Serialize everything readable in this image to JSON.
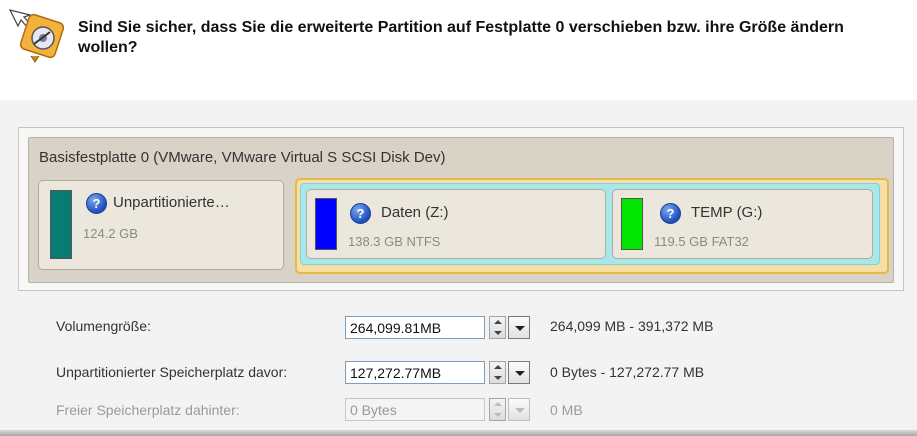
{
  "question": "Sind Sie sicher, dass Sie die erweiterte Partition auf Festplatte 0 verschieben bzw. ihre Größe ändern wollen?",
  "disk": {
    "title": "Basisfestplatte 0 (VMware, VMware Virtual S SCSI Disk Dev)",
    "partitions": [
      {
        "name": "Unpartitionierte…",
        "info": "124.2 GB",
        "color": "#0a7b72"
      },
      {
        "name": "Daten (Z:)",
        "info": "138.3 GB NTFS",
        "color": "#0000ff"
      },
      {
        "name": "TEMP (G:)",
        "info": "119.5 GB FAT32",
        "color": "#00e600"
      }
    ],
    "help_symbol": "?"
  },
  "form": {
    "volume_size": {
      "label": "Volumengröße:",
      "value": "264,099.81MB",
      "range": "264,099 MB - 391,372 MB"
    },
    "unallocated_before": {
      "label": "Unpartitionierter Speicherplatz davor:",
      "value": "127,272.77MB",
      "range": "0 Bytes - 127,272.77 MB"
    },
    "free_after": {
      "label": "Freier Speicherplatz dahinter:",
      "value": "0 Bytes",
      "range": "0 MB"
    }
  },
  "icons": {
    "wizard": "wizard-resize-icon",
    "help": "help-icon"
  }
}
